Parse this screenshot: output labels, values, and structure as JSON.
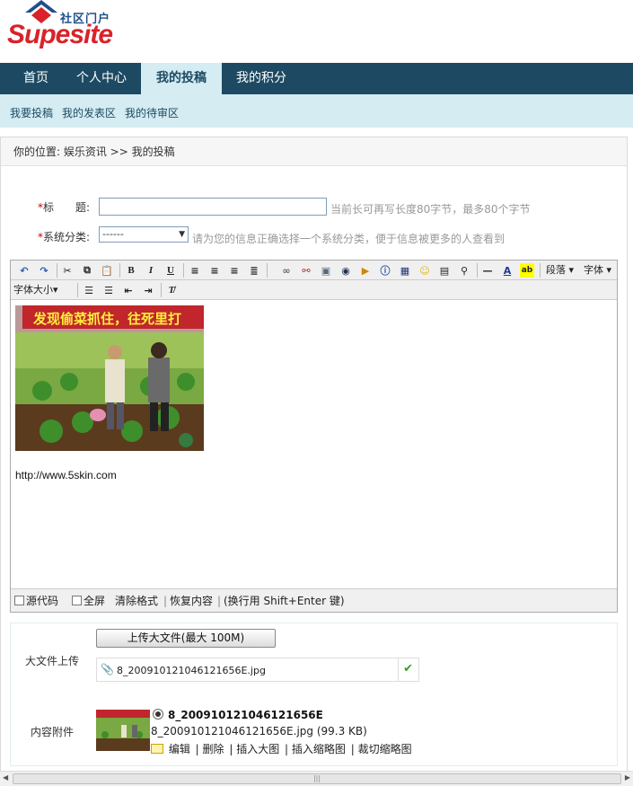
{
  "logo": {
    "cn": "社区门户",
    "en": "Supesite"
  },
  "nav": {
    "tabs": [
      {
        "label": "首页"
      },
      {
        "label": "个人中心"
      },
      {
        "label": "我的投稿"
      },
      {
        "label": "我的积分"
      }
    ],
    "active_index": 2
  },
  "subnav": {
    "items": [
      {
        "label": "我要投稿"
      },
      {
        "label": "我的发表区"
      },
      {
        "label": "我的待审区"
      }
    ]
  },
  "breadcrumb": "你的位置: 娱乐资讯 >> 我的投稿",
  "form": {
    "title_label": "标　　题:",
    "title_value": "",
    "title_hint": "当前长可再写长度80字节，最多80个字节",
    "category_label": "系统分类:",
    "category_value": "------",
    "category_hint": "请为您的信息正确选择一个系统分类，便于信息被更多的人查看到"
  },
  "editor": {
    "paragraph_label": "段落",
    "font_label": "字体",
    "fontsize_label": "字体大小",
    "content_url": "http://www.5skin.com",
    "image_caption": "发现偷菜抓住，往死里打",
    "bottom": {
      "source_code": "源代码",
      "fullscreen": "全屏",
      "clear_format": "清除格式",
      "restore": "恢复内容",
      "hint": "(换行用 Shift+Enter 键)"
    }
  },
  "attachments": {
    "upload_label": "大文件上传",
    "upload_button": "上传大文件(最大 100M)",
    "uploaded_file": "8_200910121046121656E.jpg",
    "content_label": "内容附件",
    "item_title": "8_200910121046121656E",
    "item_file": "8_200910121046121656E.jpg (99.3 KB)",
    "actions": [
      "编辑",
      "删除",
      "插入大图",
      "插入缩略图",
      "裁切缩略图"
    ]
  },
  "colors": {
    "nav_bg": "#1d4a62",
    "subnav_bg": "#d4ecf2",
    "logo_red": "#d8232a",
    "logo_blue": "#1f4f8c",
    "required": "#cc0000"
  }
}
